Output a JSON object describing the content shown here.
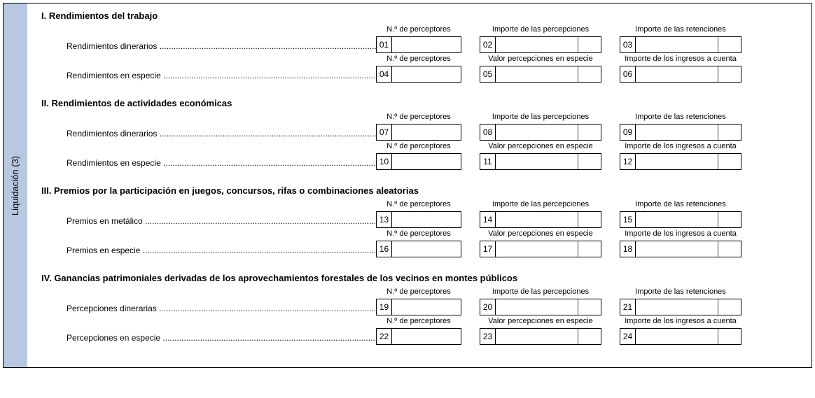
{
  "sidebar": {
    "label": "Liquidación (3)"
  },
  "headers": {
    "perceptores": "N.º de perceptores",
    "importe_percepciones": "Importe de las percepciones",
    "importe_retenciones": "Importe de las retenciones",
    "valor_especie": "Valor percepciones en especie",
    "ingresos_cuenta": "Importe de los ingresos a cuenta"
  },
  "sections": [
    {
      "roman": "I.",
      "title": "Rendimientos del trabajo",
      "rows": [
        {
          "label": "Rendimientos dinerarios",
          "type": "dinerario",
          "boxes": [
            "01",
            "02",
            "03"
          ]
        },
        {
          "label": "Rendimientos en especie",
          "type": "especie",
          "boxes": [
            "04",
            "05",
            "06"
          ]
        }
      ]
    },
    {
      "roman": "II.",
      "title": "Rendimientos de actividades económicas",
      "rows": [
        {
          "label": "Rendimientos dinerarios",
          "type": "dinerario",
          "boxes": [
            "07",
            "08",
            "09"
          ]
        },
        {
          "label": "Rendimientos en especie",
          "type": "especie",
          "boxes": [
            "10",
            "11",
            "12"
          ]
        }
      ]
    },
    {
      "roman": "III.",
      "title": "Premios por la participación en juegos, concursos, rifas o combinaciones aleatorias",
      "rows": [
        {
          "label": "Premios en metálico",
          "type": "dinerario",
          "boxes": [
            "13",
            "14",
            "15"
          ]
        },
        {
          "label": "Premios en especie",
          "type": "especie",
          "boxes": [
            "16",
            "17",
            "18"
          ]
        }
      ]
    },
    {
      "roman": "IV.",
      "title": "Ganancias patrimoniales derivadas de los aprovechamientos forestales de los vecinos en montes públicos",
      "rows": [
        {
          "label": "Percepciones dinerarias",
          "type": "dinerario",
          "boxes": [
            "19",
            "20",
            "21"
          ]
        },
        {
          "label": "Percepciones en especie",
          "type": "especie",
          "boxes": [
            "22",
            "23",
            "24"
          ]
        }
      ]
    }
  ]
}
